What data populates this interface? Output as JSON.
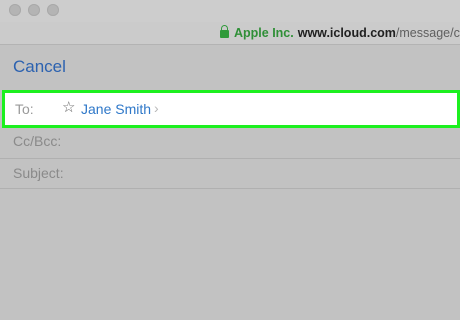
{
  "window": {
    "buttons": [
      "close",
      "minimize",
      "zoom"
    ]
  },
  "address_bar": {
    "lock_icon": "lock-icon",
    "organization": "Apple Inc.",
    "domain": "www.icloud.com",
    "path": "/message/cu",
    "organization_color": "#2f8f37"
  },
  "compose": {
    "cancel_label": "Cancel",
    "to_label": "To:",
    "recipient": "Jane Smith",
    "recipient_chevron": "›",
    "star_icon": "star-outline-icon",
    "cc_label": "Cc/Bcc:",
    "subject_label": "Subject:",
    "accent_color": "#2c62b0",
    "highlight_color": "#1cf01f"
  }
}
